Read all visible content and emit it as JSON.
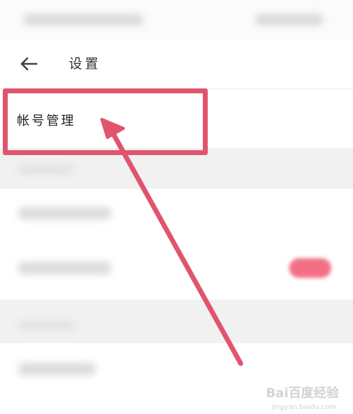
{
  "header": {
    "title": "设置"
  },
  "rows": {
    "account_management": "帐号管理"
  },
  "colors": {
    "accent_red": "#e0556d",
    "toggle_pink": "#f36f85"
  },
  "icons": {
    "back": "arrow-left-icon"
  },
  "watermark": {
    "text": "Bai百度经验",
    "sub": "jingyan.baidu.com"
  }
}
